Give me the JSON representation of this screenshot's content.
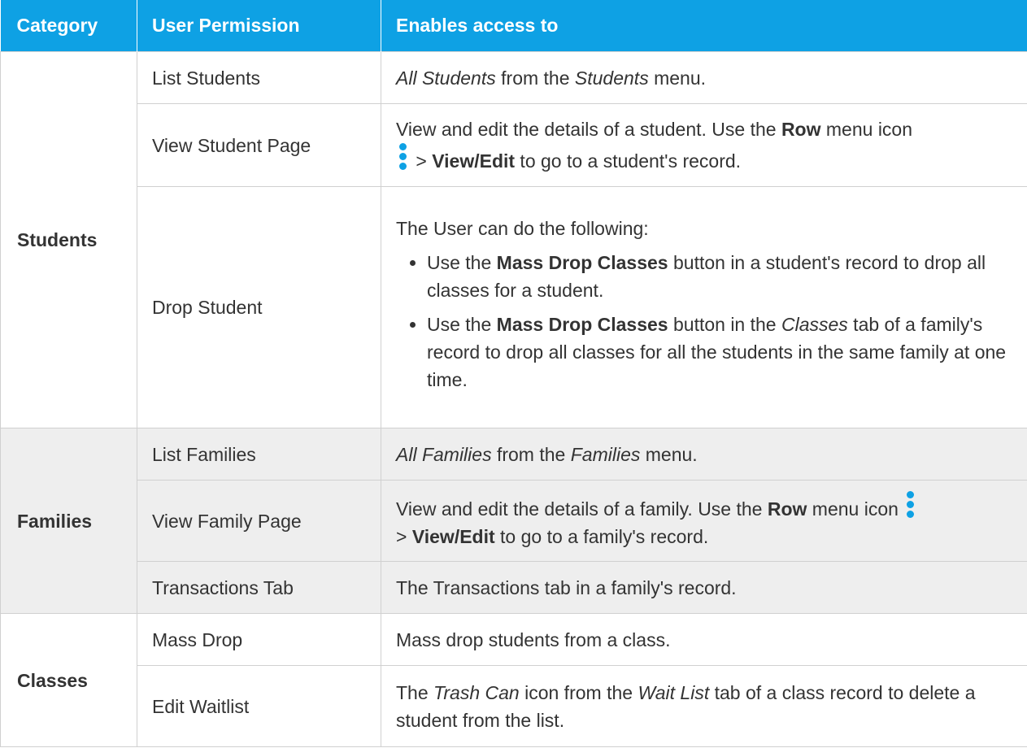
{
  "headers": [
    "Category",
    "User Permission",
    "Enables access to"
  ],
  "students": {
    "category": "Students",
    "list_students": {
      "perm": "List Students",
      "i1": "All Students",
      "t1": " from the ",
      "i2": "Students",
      "t2": " menu."
    },
    "view_student": {
      "perm": "View Student Page",
      "t1": "View and edit the details of a student. Use the ",
      "b1": "Row",
      "t2": " menu icon ",
      "t3": " > ",
      "b2": "View/Edit",
      "t4": " to go to a student's record."
    },
    "drop_student": {
      "perm": "Drop Student",
      "intro": "The User can do the following:",
      "li1_t1": "Use the ",
      "li1_b1": "Mass Drop Classes",
      "li1_t2": " button in a student's record to drop all classes for a student.",
      "li2_t1": "Use the ",
      "li2_b1": "Mass Drop Classes",
      "li2_t2": " button in the ",
      "li2_i1": "Classes",
      "li2_t3": " tab of a family's record to drop all classes for all the students in the same family at one time."
    }
  },
  "families": {
    "category": "Families",
    "list_families": {
      "perm": "List Families",
      "i1": "All Families",
      "t1": " from the ",
      "i2": "Families",
      "t2": " menu."
    },
    "view_family": {
      "perm": "View Family Page",
      "t1": "View and edit the details of a family. Use the ",
      "b1": "Row",
      "t2": " menu icon ",
      "t3": " > ",
      "b2": "View/Edit",
      "t4": " to go to a family's record."
    },
    "transactions": {
      "perm": "Transactions Tab",
      "t1": "The Transactions tab in a family's record."
    }
  },
  "classes": {
    "category": "Classes",
    "mass_drop": {
      "perm": "Mass Drop",
      "t1": "Mass drop students from a class."
    },
    "edit_waitlist": {
      "perm": "Edit Waitlist",
      "t1": "The ",
      "i1": "Trash Can",
      "t2": " icon from the ",
      "i2": "Wait List",
      "t3": " tab of a class record to delete a student from the list."
    }
  },
  "colors": {
    "header_bg": "#0ea1e4",
    "icon": "#0ea1e4",
    "alt_row_bg": "#eeeeee"
  },
  "icons": {
    "row_menu": "vertical-dots-icon"
  }
}
